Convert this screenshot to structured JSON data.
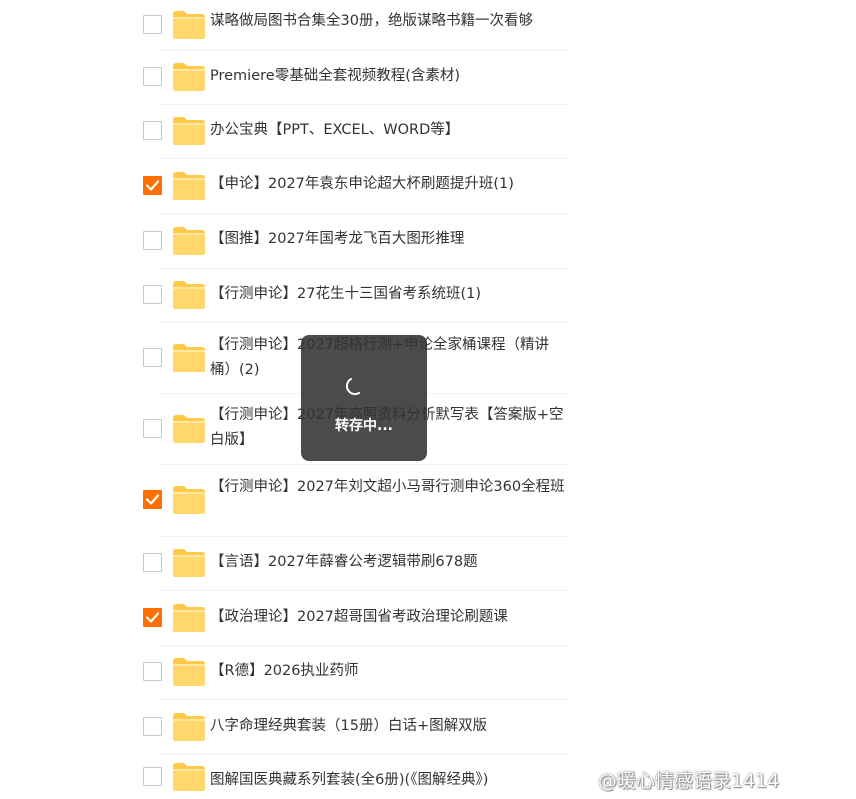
{
  "files": [
    {
      "name": "谋略做局图书合集全30册，绝版谋略书籍一次看够",
      "checked": false
    },
    {
      "name": "Premiere零基础全套视频教程(含素材)",
      "checked": false
    },
    {
      "name": "办公宝典【PPT、EXCEL、WORD等】",
      "checked": false
    },
    {
      "name": "【申论】2027年袁东申论超大杯刷题提升班(1)",
      "checked": true
    },
    {
      "name": "【图推】2027年国考龙飞百大图形推理",
      "checked": false
    },
    {
      "name": "【行测申论】27花生十三国省考系统班(1)",
      "checked": false
    },
    {
      "name": "【行测申论】2027超格行测+申论全家桶课程（精讲桶）(2)",
      "checked": false
    },
    {
      "name": "【行测申论】2027年高照资料分析默写表【答案版+空白版】",
      "checked": false
    },
    {
      "name": "【行测申论】2027年刘文超小马哥行测申论360全程班",
      "checked": true
    },
    {
      "name": "【言语】2027年薛睿公考逻辑带刷678题",
      "checked": false
    },
    {
      "name": "【政治理论】2027超哥国省考政治理论刷题课",
      "checked": true
    },
    {
      "name": "【R德】2026执业药师",
      "checked": false
    },
    {
      "name": "八字命理经典套装（15册）白话+图解双版",
      "checked": false
    },
    {
      "name": "图解国医典藏系列套装(全6册)(《图解经典》)",
      "checked": false
    }
  ],
  "toast": {
    "text": "转存中..."
  },
  "watermark": {
    "text": "@暖心情感语录1414"
  },
  "icons": {
    "folder": "folder-icon",
    "check": "check-icon",
    "spinner": "loading-spinner-icon",
    "weibo": "weibo-logo-icon"
  },
  "colors": {
    "accent": "#ff6f00",
    "folder": "#ffd76b",
    "folder_dark": "#ffc94a"
  }
}
